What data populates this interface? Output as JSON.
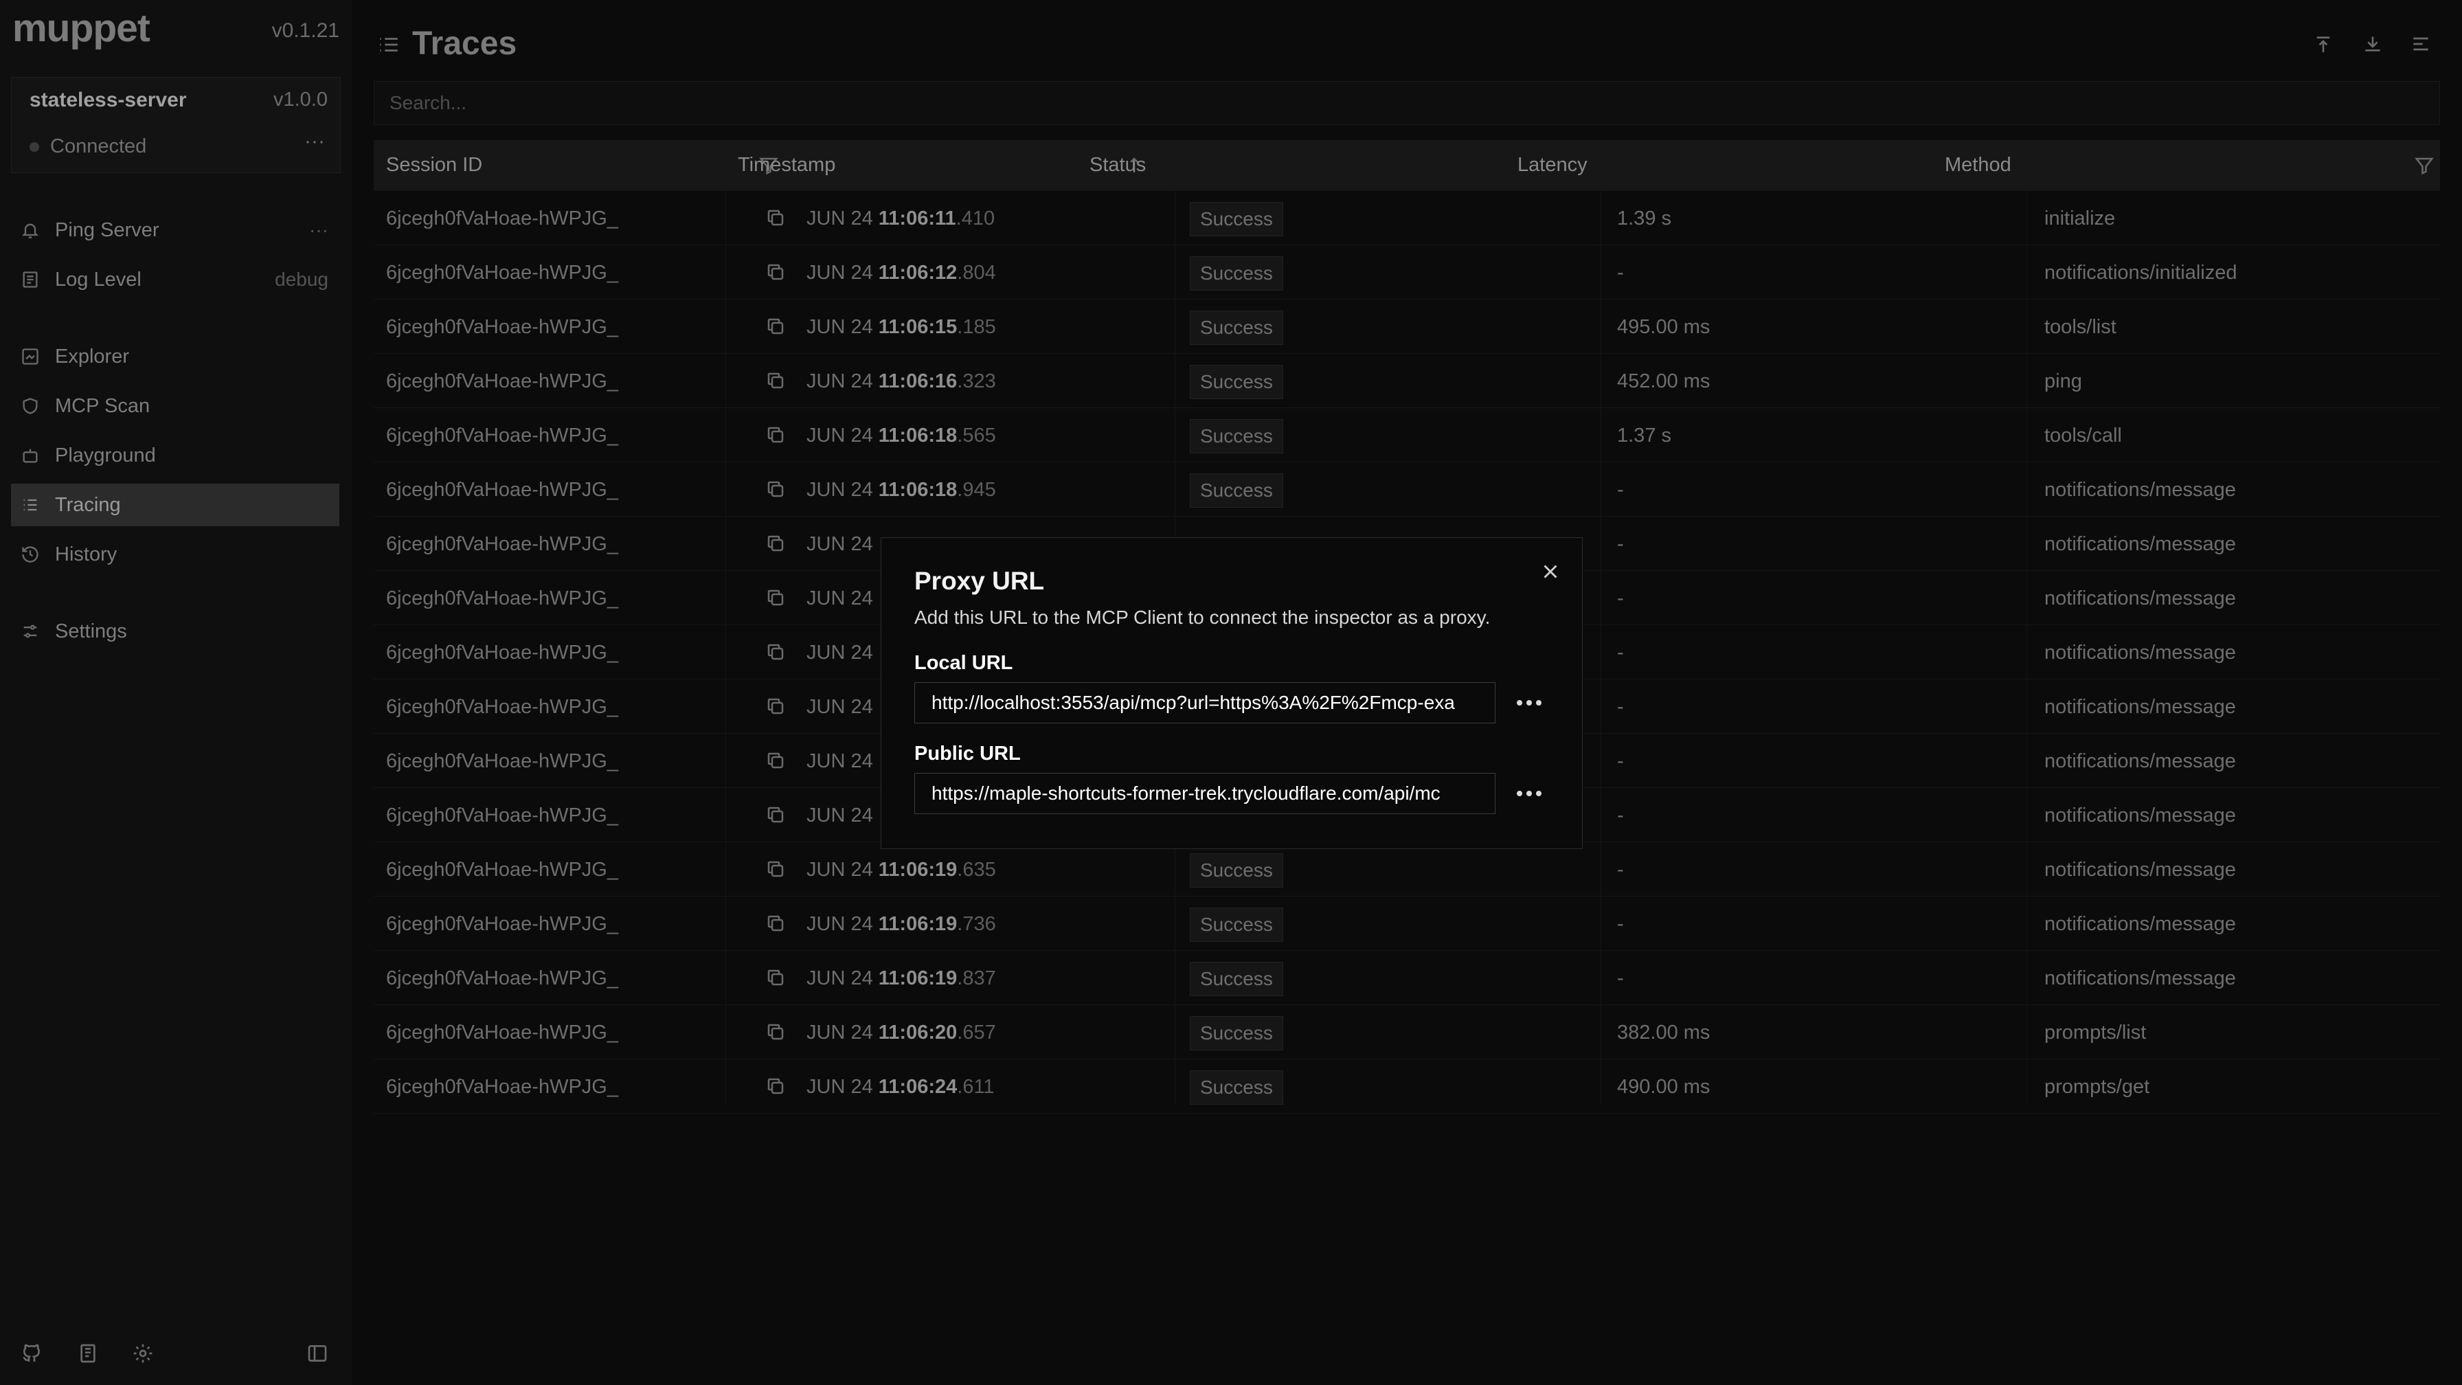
{
  "app": {
    "name": "muppet",
    "version": "v0.1.21"
  },
  "server": {
    "name": "stateless-server",
    "version": "v1.0.0",
    "status": "Connected",
    "more": "···"
  },
  "nav": {
    "ping": {
      "label": "Ping Server",
      "right": "···"
    },
    "log_level": {
      "label": "Log Level",
      "value": "debug"
    },
    "explorer": {
      "label": "Explorer"
    },
    "mcp_scan": {
      "label": "MCP Scan"
    },
    "playground": {
      "label": "Playground"
    },
    "tracing": {
      "label": "Tracing"
    },
    "history": {
      "label": "History"
    },
    "settings": {
      "label": "Settings"
    }
  },
  "page": {
    "title": "Traces"
  },
  "search": {
    "placeholder": "Search..."
  },
  "table": {
    "headers": {
      "session": "Session ID",
      "timestamp": "Timestamp",
      "status": "Status",
      "latency": "Latency",
      "method": "Method"
    },
    "rows": [
      {
        "session": "6jcegh0fVaHoae-hWPJG_",
        "date": "JUN 24",
        "time": "11:06:11",
        "ms": ".410",
        "status": "Success",
        "latency": "1.39 s",
        "method": "initialize"
      },
      {
        "session": "6jcegh0fVaHoae-hWPJG_",
        "date": "JUN 24",
        "time": "11:06:12",
        "ms": ".804",
        "status": "Success",
        "latency": "-",
        "method": "notifications/initialized"
      },
      {
        "session": "6jcegh0fVaHoae-hWPJG_",
        "date": "JUN 24",
        "time": "11:06:15",
        "ms": ".185",
        "status": "Success",
        "latency": "495.00 ms",
        "method": "tools/list"
      },
      {
        "session": "6jcegh0fVaHoae-hWPJG_",
        "date": "JUN 24",
        "time": "11:06:16",
        "ms": ".323",
        "status": "Success",
        "latency": "452.00 ms",
        "method": "ping"
      },
      {
        "session": "6jcegh0fVaHoae-hWPJG_",
        "date": "JUN 24",
        "time": "11:06:18",
        "ms": ".565",
        "status": "Success",
        "latency": "1.37 s",
        "method": "tools/call"
      },
      {
        "session": "6jcegh0fVaHoae-hWPJG_",
        "date": "JUN 24",
        "time": "11:06:18",
        "ms": ".945",
        "status": "Success",
        "latency": "-",
        "method": "notifications/message"
      },
      {
        "session": "6jcegh0fVaHoae-hWPJG_",
        "date": "JUN 24",
        "time": "",
        "ms": "",
        "status": "",
        "latency": "-",
        "method": "notifications/message"
      },
      {
        "session": "6jcegh0fVaHoae-hWPJG_",
        "date": "JUN 24",
        "time": "",
        "ms": "",
        "status": "",
        "latency": "-",
        "method": "notifications/message"
      },
      {
        "session": "6jcegh0fVaHoae-hWPJG_",
        "date": "JUN 24",
        "time": "",
        "ms": "",
        "status": "",
        "latency": "-",
        "method": "notifications/message"
      },
      {
        "session": "6jcegh0fVaHoae-hWPJG_",
        "date": "JUN 24",
        "time": "",
        "ms": "",
        "status": "",
        "latency": "-",
        "method": "notifications/message"
      },
      {
        "session": "6jcegh0fVaHoae-hWPJG_",
        "date": "JUN 24",
        "time": "",
        "ms": "",
        "status": "",
        "latency": "-",
        "method": "notifications/message"
      },
      {
        "session": "6jcegh0fVaHoae-hWPJG_",
        "date": "JUN 24",
        "time": "",
        "ms": "",
        "status": "",
        "latency": "-",
        "method": "notifications/message"
      },
      {
        "session": "6jcegh0fVaHoae-hWPJG_",
        "date": "JUN 24",
        "time": "11:06:19",
        "ms": ".635",
        "status": "Success",
        "latency": "-",
        "method": "notifications/message"
      },
      {
        "session": "6jcegh0fVaHoae-hWPJG_",
        "date": "JUN 24",
        "time": "11:06:19",
        "ms": ".736",
        "status": "Success",
        "latency": "-",
        "method": "notifications/message"
      },
      {
        "session": "6jcegh0fVaHoae-hWPJG_",
        "date": "JUN 24",
        "time": "11:06:19",
        "ms": ".837",
        "status": "Success",
        "latency": "-",
        "method": "notifications/message"
      },
      {
        "session": "6jcegh0fVaHoae-hWPJG_",
        "date": "JUN 24",
        "time": "11:06:20",
        "ms": ".657",
        "status": "Success",
        "latency": "382.00 ms",
        "method": "prompts/list"
      },
      {
        "session": "6jcegh0fVaHoae-hWPJG_",
        "date": "JUN 24",
        "time": "11:06:24",
        "ms": ".611",
        "status": "Success",
        "latency": "490.00 ms",
        "method": "prompts/get"
      }
    ]
  },
  "modal": {
    "title": "Proxy URL",
    "description": "Add this URL to the MCP Client to connect the inspector as a proxy.",
    "local_label": "Local URL",
    "local_value": "http://localhost:3553/api/mcp?url=https%3A%2F%2Fmcp-exa",
    "public_label": "Public URL",
    "public_value": "https://maple-shortcuts-former-trek.trycloudflare.com/api/mc",
    "more": "···"
  },
  "icons": {
    "bell": "bell-icon",
    "log": "log-icon",
    "explorer": "explorer-icon",
    "shield": "shield-icon",
    "playground": "playground-icon",
    "list": "list-icon",
    "history": "history-icon",
    "sliders": "sliders-icon",
    "github": "github-icon",
    "book": "book-icon",
    "gear": "gear-icon",
    "sidebar": "sidebar-toggle-icon",
    "copy": "copy-icon",
    "filter": "filter-icon",
    "sort": "sort-up-icon",
    "close": "close-icon",
    "proxy": "proxy-icon",
    "download": "download-icon",
    "menu": "menu-icon"
  }
}
